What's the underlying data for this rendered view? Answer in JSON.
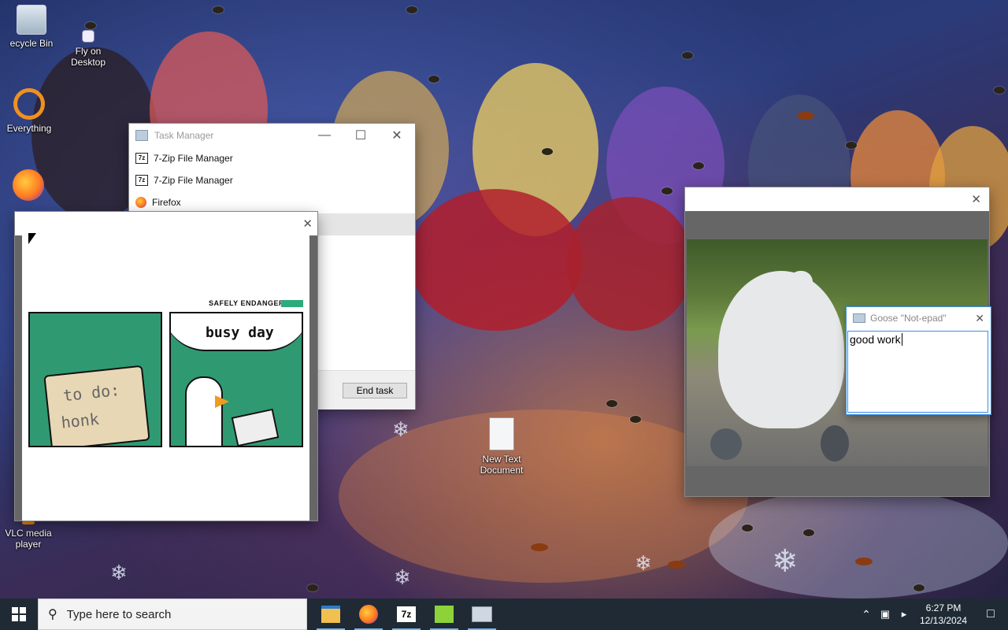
{
  "desktop": {
    "icons": [
      {
        "label": "ecycle Bin"
      },
      {
        "label": "Fly on\nDesktop"
      },
      {
        "label": "Everything"
      },
      {
        "label": "VLC media\nplayer"
      },
      {
        "label": "New Text\nDocument"
      }
    ]
  },
  "task_manager": {
    "title": "Task Manager",
    "processes": [
      {
        "name": "7-Zip File Manager",
        "icon": "7zip-icon"
      },
      {
        "name": "7-Zip File Manager",
        "icon": "7zip-icon"
      },
      {
        "name": "Firefox",
        "icon": "firefox-icon"
      }
    ],
    "end_task_label": "End task"
  },
  "meme_window": {
    "header_text": "SAFELY ENDANGERED",
    "panel1_text_line1": "to do:",
    "panel1_text_line2": "honk",
    "panel2_caption": "busy day"
  },
  "notepad": {
    "title": "Goose \"Not-epad\"",
    "content": "good work"
  },
  "taskbar": {
    "search_placeholder": "Type here to search",
    "time": "6:27 PM",
    "date": "12/13/2024"
  }
}
